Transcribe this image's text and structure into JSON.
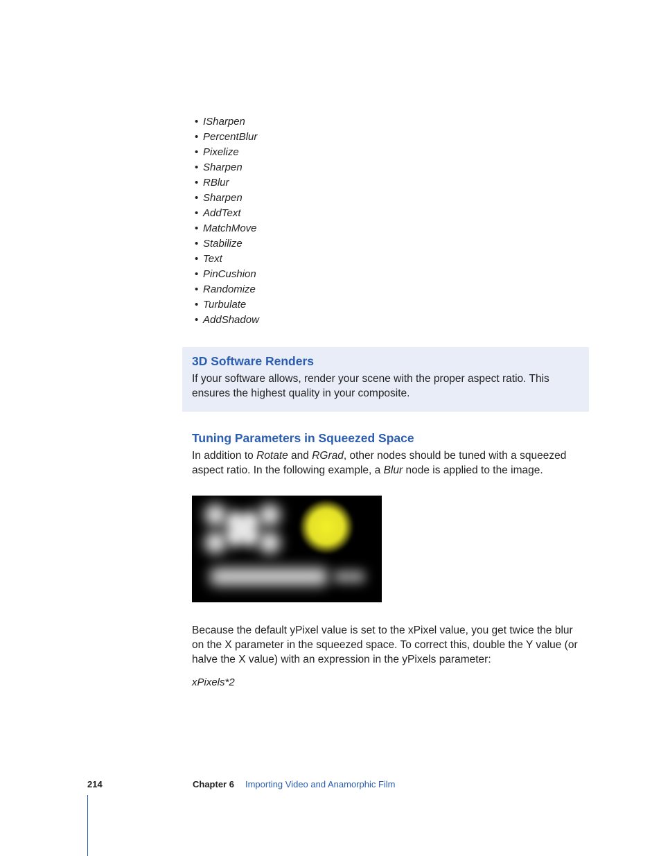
{
  "bullets": {
    "b0": "ISharpen",
    "b1": "PercentBlur",
    "b2": "Pixelize",
    "b3": "Sharpen",
    "b4": "RBlur",
    "b5": "Sharpen",
    "b6": "AddText",
    "b7": "MatchMove",
    "b8": "Stabilize",
    "b9": "Text",
    "b10": "PinCushion",
    "b11": "Randomize",
    "b12": "Turbulate",
    "b13": "AddShadow"
  },
  "section1": {
    "heading": "3D Software Renders",
    "body": "If your software allows, render your scene with the proper aspect ratio. This ensures the highest quality in your composite."
  },
  "section2": {
    "heading": "Tuning Parameters in Squeezed Space",
    "p1a": "In addition to ",
    "i1": "Rotate",
    "p1b": " and ",
    "i2": "RGrad",
    "p1c": ", other nodes should be tuned with a squeezed aspect ratio. In the following example, a ",
    "i3": "Blur",
    "p1d": " node is applied to the image.",
    "p2": "Because the default yPixel value is set to the xPixel value, you get twice the blur on the X parameter in the squeezed space. To correct this, double the Y value (or halve the X value) with an expression in the yPixels parameter:",
    "expr": "xPixels*2"
  },
  "footer": {
    "page": "214",
    "chapter_label": "Chapter 6",
    "chapter_title": "Importing Video and Anamorphic Film"
  }
}
